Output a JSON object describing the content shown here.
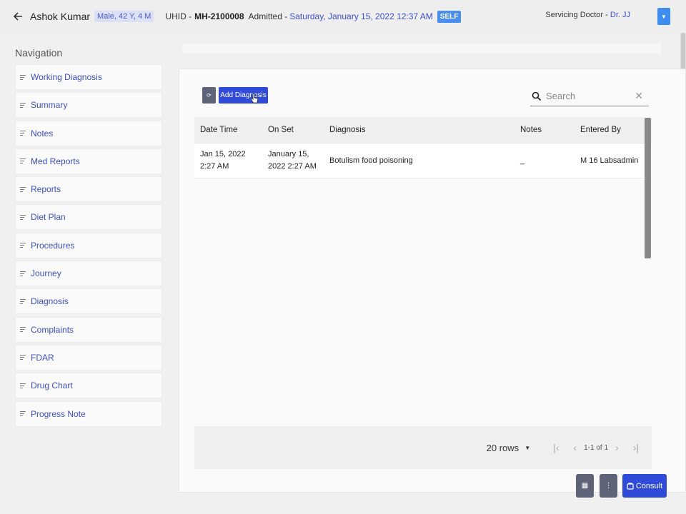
{
  "header": {
    "patient_name": "Ashok Kumar",
    "patient_tag": "Male, 42 Y, 4 M",
    "uhid_label": "UHID -",
    "uhid_value": "MH-2100008",
    "admitted_label": "Admitted -",
    "admitted_date": "Saturday, January 15, 2022 12:37 AM",
    "self_badge": "SELF",
    "doctor_label": "Servicing Doctor -",
    "doctor_name": "Dr. JJ"
  },
  "nav": {
    "title": "Navigation",
    "items": [
      {
        "label": "Working Diagnosis"
      },
      {
        "label": "Summary"
      },
      {
        "label": "Notes"
      },
      {
        "label": "Med Reports"
      },
      {
        "label": "Reports"
      },
      {
        "label": "Diet Plan"
      },
      {
        "label": "Procedures"
      },
      {
        "label": "Journey"
      },
      {
        "label": "Diagnosis"
      },
      {
        "label": "Complaints"
      },
      {
        "label": "FDAR"
      },
      {
        "label": "Drug Chart"
      },
      {
        "label": "Progress Note"
      }
    ]
  },
  "toolbar": {
    "refresh_label": "⟳",
    "add_label": "Add Diagnosis"
  },
  "search": {
    "placeholder": "Search",
    "value": ""
  },
  "table": {
    "columns": [
      "Date Time",
      "On Set",
      "Diagnosis",
      "Notes",
      "Entered By"
    ],
    "rows": [
      {
        "date_time": "Jan 15, 2022 2:27 AM",
        "on_set": "January 15, 2022 2:27 AM",
        "diagnosis": "Botulism food poisoning",
        "notes": "_",
        "entered_by": "M 16 Labsadmin"
      }
    ]
  },
  "pagination": {
    "rows_label": "20 rows",
    "page_info": "1-1 of 1"
  },
  "fabs": {
    "grid_label": "▦",
    "more_label": "⋮",
    "consult_label": "Consult"
  },
  "colors": {
    "primary": "#2f4bd8",
    "secondary": "#5f6377",
    "accent_blue": "#4a8ff0",
    "link": "#3c4fc2"
  }
}
